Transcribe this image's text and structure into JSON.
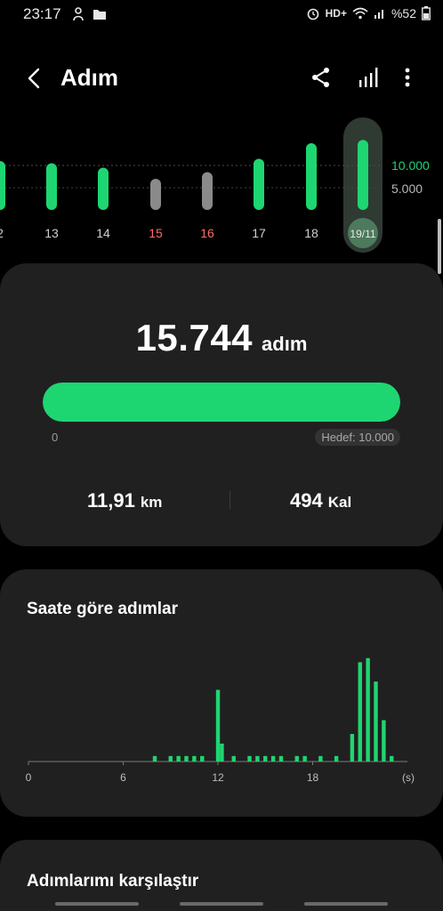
{
  "status_bar": {
    "time": "23:17",
    "network": "HD+",
    "battery": "%52",
    "icons": [
      "alarm-icon",
      "wifi-icon",
      "signal-icon",
      "battery-icon"
    ]
  },
  "header": {
    "title": "Adım",
    "icons": [
      "back-arrow-icon",
      "share-icon",
      "bar-chart-icon",
      "more-options-icon"
    ]
  },
  "daily_chart": {
    "days": [
      "2",
      "13",
      "14",
      "15",
      "16",
      "17",
      "18",
      "19/11"
    ],
    "steps": [
      11000,
      10500,
      9500,
      7000,
      8500,
      11500,
      15000,
      15744
    ],
    "weekend": [
      false,
      false,
      false,
      true,
      true,
      false,
      false,
      false
    ],
    "reference_labels": [
      "10.000",
      "5.000"
    ],
    "selected_index": 7
  },
  "summary": {
    "steps": "15.744",
    "steps_unit": "adım",
    "progress_fraction": 1.0,
    "progress_min": "0",
    "goal_label": "Hedef: 10.000",
    "distance_value": "11,91",
    "distance_unit": "km",
    "calories_value": "494",
    "calories_unit": "Kal"
  },
  "hourly": {
    "title": "Saate göre adımlar",
    "x_ticks": [
      "0",
      "6",
      "12",
      "18"
    ],
    "x_unit": "(s)",
    "chart_data": {
      "type": "bar",
      "x": [
        8.0,
        9.0,
        9.5,
        10.0,
        10.5,
        11.0,
        12.0,
        12.25,
        13.0,
        14.0,
        14.5,
        15.0,
        15.5,
        16.0,
        17.0,
        17.5,
        18.5,
        19.5,
        20.5,
        21.0,
        21.5,
        22.0,
        22.5,
        23.0
      ],
      "values": [
        4,
        4,
        4,
        4,
        4,
        4,
        52,
        13,
        4,
        4,
        4,
        4,
        4,
        4,
        4,
        4,
        4,
        4,
        20,
        72,
        75,
        58,
        30,
        4
      ],
      "title": "Saate göre adımlar",
      "xlabel": "(s)",
      "xlim": [
        0,
        24
      ]
    }
  },
  "compare": {
    "title": "Adımlarımı karşılaştır"
  },
  "colors": {
    "accent": "#1ed671",
    "weekend_bar": "#8a8a8a",
    "weekend_label": "#ff6b6b",
    "card": "#202020",
    "selected_pill": "#2f3a33"
  }
}
